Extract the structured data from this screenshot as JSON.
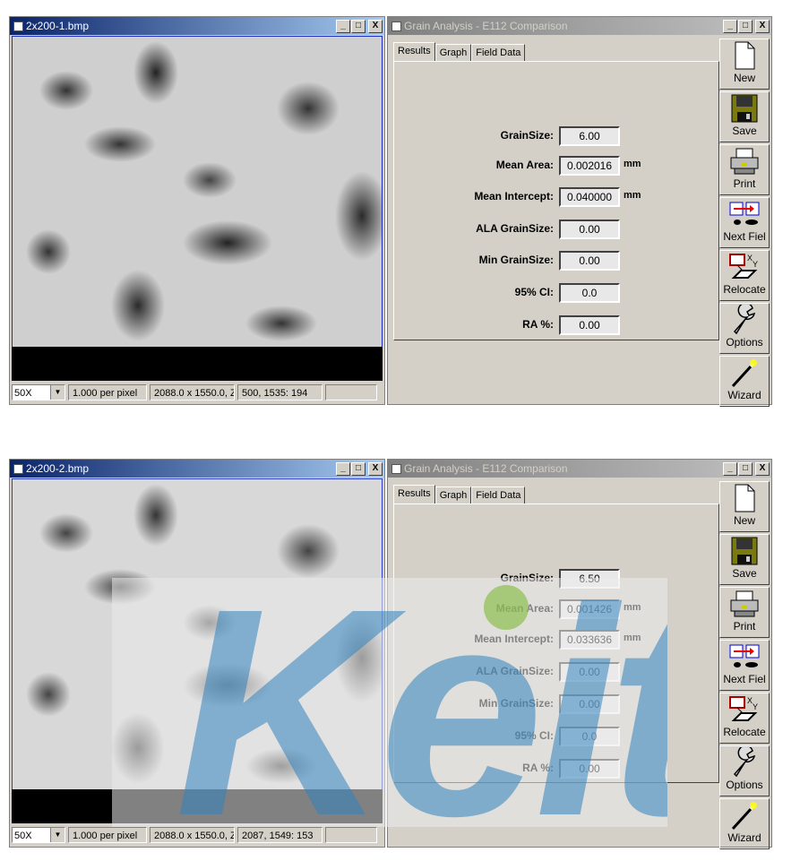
{
  "panels": [
    {
      "image_window": {
        "title": "2x200-1.bmp",
        "zoom": "50X",
        "scale": "1.000  per pixel",
        "dimensions": "2088.0 x 1550.0, Z",
        "cursor": "500, 1535: 194"
      },
      "app_window": {
        "title": "Grain Analysis - E112 Comparison",
        "tabs": [
          "Results",
          "Graph",
          "Field Data"
        ],
        "selected_tab": "Results",
        "fields": [
          {
            "label": "GrainSize:",
            "value": "6.00",
            "unit": ""
          },
          {
            "label": "Mean Area:",
            "value": "0.002016",
            "unit": "mm"
          },
          {
            "label": "Mean Intercept:",
            "value": "0.040000",
            "unit": "mm"
          },
          {
            "label": "ALA GrainSize:",
            "value": "0.00",
            "unit": ""
          },
          {
            "label": "Min GrainSize:",
            "value": "0.00",
            "unit": ""
          },
          {
            "label": "95% CI:",
            "value": "0.0",
            "unit": ""
          },
          {
            "label": "RA %:",
            "value": "0.00",
            "unit": ""
          }
        ]
      }
    },
    {
      "image_window": {
        "title": "2x200-2.bmp",
        "zoom": "50X",
        "scale": "1.000  per pixel",
        "dimensions": "2088.0 x 1550.0, Z",
        "cursor": "2087, 1549: 153"
      },
      "app_window": {
        "title": "Grain Analysis - E112 Comparison",
        "tabs": [
          "Results",
          "Graph",
          "Field Data"
        ],
        "selected_tab": "Results",
        "fields": [
          {
            "label": "GrainSize:",
            "value": "6.50",
            "unit": ""
          },
          {
            "label": "Mean Area:",
            "value": "0.001426",
            "unit": "mm"
          },
          {
            "label": "Mean Intercept:",
            "value": "0.033636",
            "unit": "mm"
          },
          {
            "label": "ALA GrainSize:",
            "value": "0.00",
            "unit": ""
          },
          {
            "label": "Min GrainSize:",
            "value": "0.00",
            "unit": ""
          },
          {
            "label": "95% CI:",
            "value": "0.0",
            "unit": ""
          },
          {
            "label": "RA %:",
            "value": "0.00",
            "unit": ""
          }
        ]
      }
    }
  ],
  "toolbar": [
    {
      "label": "New",
      "icon": "new-document-icon"
    },
    {
      "label": "Save",
      "icon": "floppy-disk-icon"
    },
    {
      "label": "Print",
      "icon": "printer-icon"
    },
    {
      "label": "Next Fiel",
      "icon": "next-field-icon"
    },
    {
      "label": "Relocate",
      "icon": "relocate-icon"
    },
    {
      "label": "Options",
      "icon": "wrench-icon"
    },
    {
      "label": "Wizard",
      "icon": "magic-wand-icon"
    }
  ],
  "window_buttons": {
    "minimize": "_",
    "maximize": "□",
    "close": "X"
  },
  "watermark": {
    "text": "Keit",
    "pattern": "KEIT"
  },
  "colors": {
    "active_title": "#0a246a",
    "inactive_title": "#808080",
    "face": "#d4d0c8",
    "watermark_blue": "#3282be",
    "watermark_green": "#8cbe50"
  }
}
